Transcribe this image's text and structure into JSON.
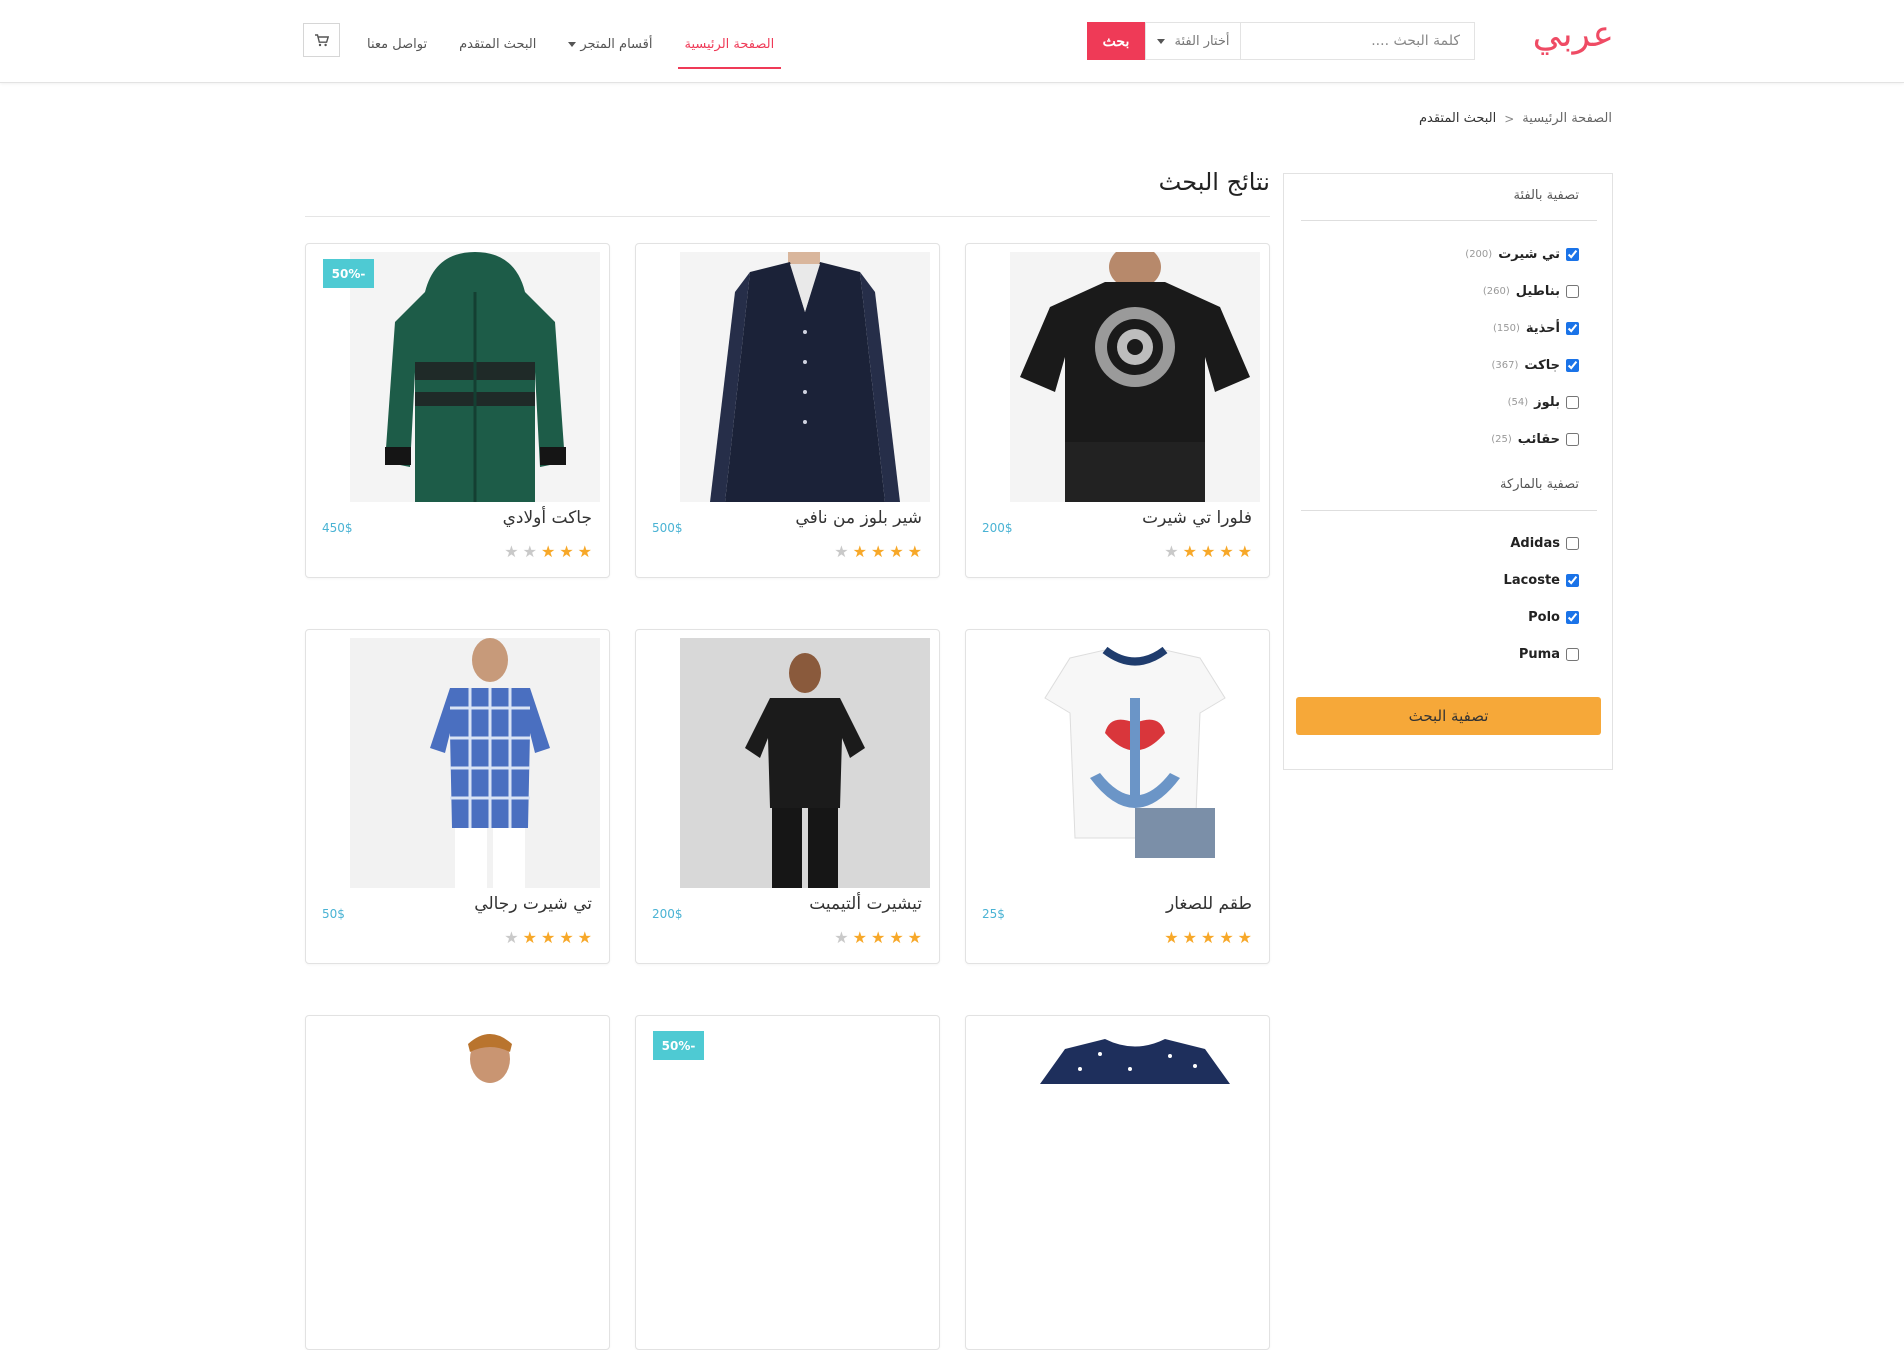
{
  "header": {
    "logo": "عربي",
    "search": {
      "placeholder": "كلمة البحث ....",
      "category_label": "أختار الفئة",
      "button_label": "بحث"
    },
    "nav": [
      {
        "label": "الصفحة الرئيسية",
        "active": true
      },
      {
        "label": "أقسام المتجر",
        "active": false
      },
      {
        "label": "البحث المتقدم",
        "active": false
      },
      {
        "label": "تواصل معنا",
        "active": false
      }
    ],
    "cart_icon": "cart-icon"
  },
  "breadcrumb": {
    "home": "الصفحة الرئيسية",
    "separator": "<",
    "current": "البحث المتقدم"
  },
  "results": {
    "title": "نتائج البحث"
  },
  "products": [
    {
      "name": "فلورا تي شيرت",
      "price": "200$",
      "rating": 4,
      "badge": ""
    },
    {
      "name": "شير بلوز من نافي",
      "price": "500$",
      "rating": 4,
      "badge": ""
    },
    {
      "name": "جاكت أولادي",
      "price": "450$",
      "rating": 3,
      "badge": "50%-"
    },
    {
      "name": "طقم للصغار",
      "price": "25$",
      "rating": 5,
      "badge": ""
    },
    {
      "name": "تيشيرت ألتيميت",
      "price": "200$",
      "rating": 4,
      "badge": ""
    },
    {
      "name": "تي شيرت رجالي",
      "price": "50$",
      "rating": 4,
      "badge": ""
    },
    {
      "name": "",
      "price": "",
      "rating": 0,
      "badge": ""
    },
    {
      "name": "",
      "price": "",
      "rating": 0,
      "badge": "50%-"
    },
    {
      "name": "",
      "price": "",
      "rating": 0,
      "badge": ""
    }
  ],
  "sidebar": {
    "category_title": "تصفية بالفئة",
    "categories": [
      {
        "label": "تي شيرت",
        "count": "(200)",
        "checked": true
      },
      {
        "label": "بناطيل",
        "count": "(260)",
        "checked": false
      },
      {
        "label": "أحذية",
        "count": "(150)",
        "checked": true
      },
      {
        "label": "جاكت",
        "count": "(367)",
        "checked": true
      },
      {
        "label": "بلوز",
        "count": "(54)",
        "checked": false
      },
      {
        "label": "حقائب",
        "count": "(25)",
        "checked": false
      }
    ],
    "brand_title": "تصفية بالماركة",
    "brands": [
      {
        "label": "Adidas",
        "checked": false
      },
      {
        "label": "Lacoste",
        "checked": true
      },
      {
        "label": "Polo",
        "checked": true
      },
      {
        "label": "Puma",
        "checked": false
      }
    ],
    "submit_label": "تصفية البحث"
  },
  "colors": {
    "accent": "#ef3a57",
    "price": "#4ab3d4",
    "badge": "#4ecad3",
    "button": "#f6a839",
    "star": "#f7a829"
  }
}
